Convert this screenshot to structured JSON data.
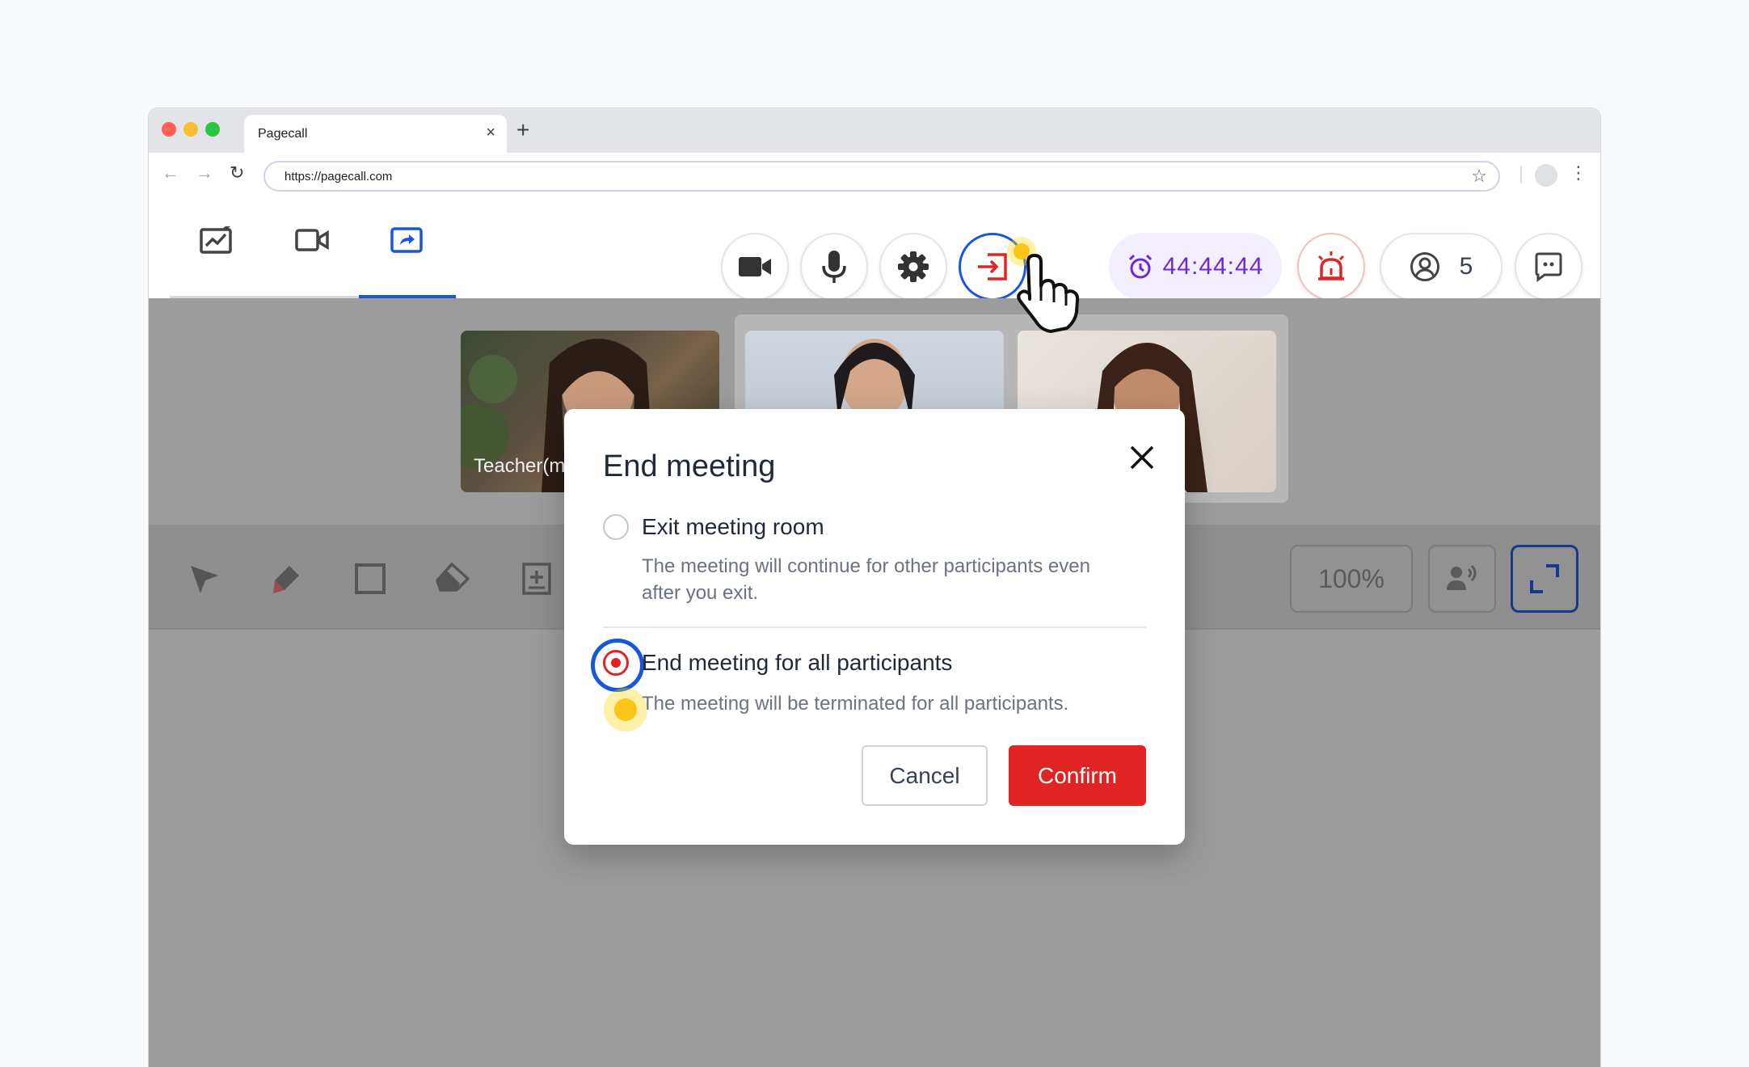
{
  "browser": {
    "tab_title": "Pagecall",
    "tab_close": "×",
    "new_tab": "+",
    "url": "https://pagecall.com",
    "nav": {
      "back": "←",
      "forward": "→",
      "reload": "↻"
    },
    "star": "☆",
    "menu": "⋮"
  },
  "toolbar": {
    "mode_tabs": [
      {
        "icon": "whiteboard-edit-icon",
        "active": false
      },
      {
        "icon": "video-camera-outline-icon",
        "active": false
      },
      {
        "icon": "screen-share-icon",
        "active": true
      }
    ],
    "controls": [
      {
        "icon": "video-camera-icon"
      },
      {
        "icon": "microphone-icon"
      },
      {
        "icon": "gear-icon"
      },
      {
        "icon": "leave-room-icon",
        "focused": true
      }
    ],
    "timer": "44:44:44",
    "participants_count": "5",
    "colors": {
      "accent": "#1a56db",
      "timer": "#6d28d9",
      "danger": "#e02424"
    }
  },
  "videos": [
    {
      "name": "Teacher(m"
    },
    {
      "name": ""
    },
    {
      "name": ""
    }
  ],
  "draw_toolbar": {
    "tools": [
      "pointer-icon",
      "pen-icon",
      "rectangle-icon",
      "eraser-icon",
      "add-page-icon"
    ],
    "zoom": "100%"
  },
  "dialog": {
    "title": "End meeting",
    "options": [
      {
        "label": "Exit meeting room",
        "description": "The meeting will continue for other participants even after you exit.",
        "checked": false
      },
      {
        "label": "End meeting for all participants",
        "description": "The meeting will be terminated for all participants.",
        "checked": true
      }
    ],
    "cancel_label": "Cancel",
    "confirm_label": "Confirm"
  }
}
